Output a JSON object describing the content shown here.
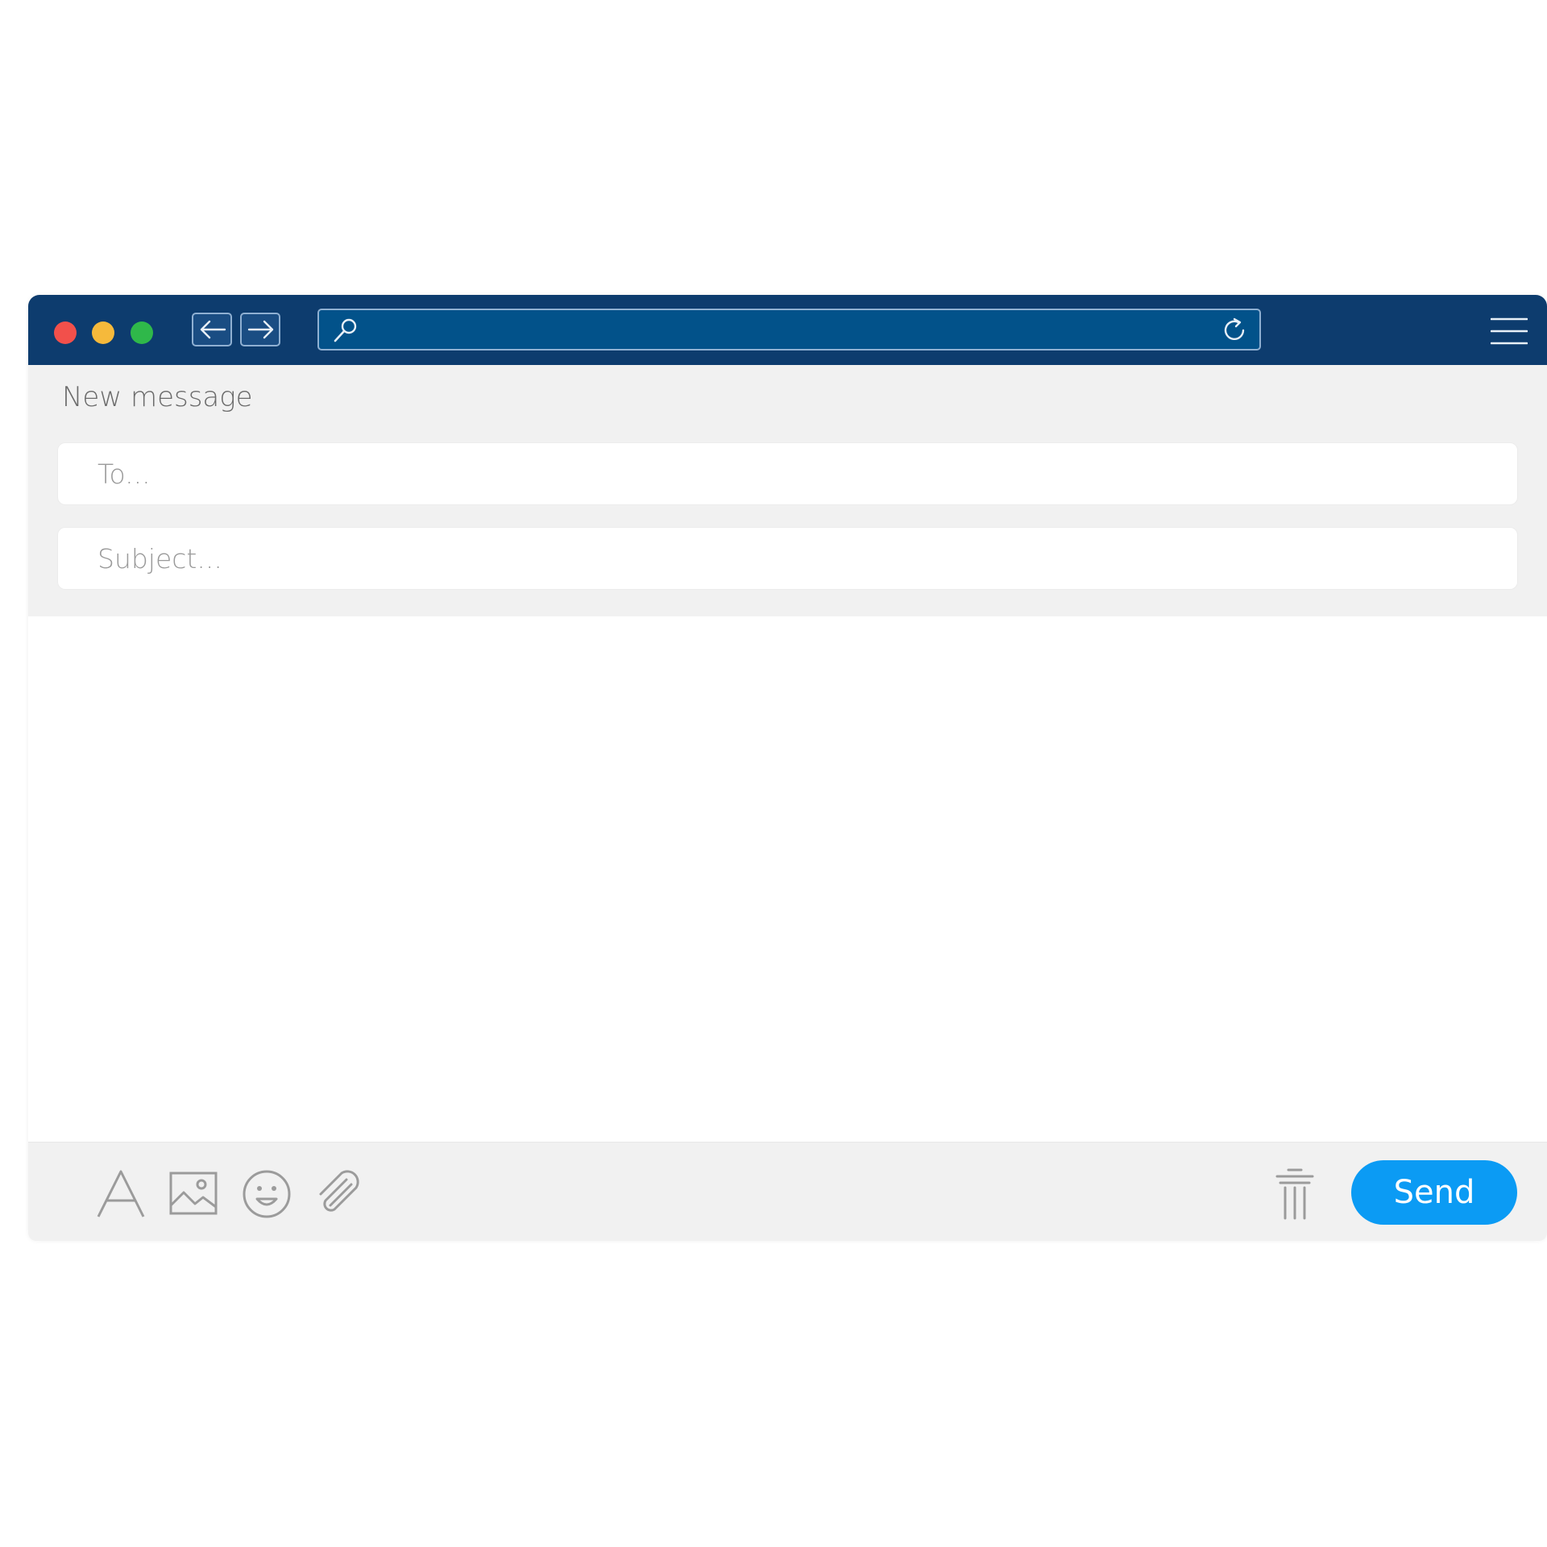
{
  "compose": {
    "heading": "New message",
    "to_placeholder": "To...",
    "subject_placeholder": "Subject...",
    "send_label": "Send"
  },
  "toolbar": {
    "icons": [
      "font-icon",
      "image-icon",
      "emoji-icon",
      "attachment-icon",
      "trash-icon"
    ]
  },
  "browser": {
    "traffic_lights": [
      "#f2504b",
      "#f6b93b",
      "#2fb84a"
    ],
    "nav_icons": [
      "back-arrow-icon",
      "forward-arrow-icon",
      "search-icon",
      "reload-icon",
      "menu-icon"
    ]
  },
  "colors": {
    "titlebar": "#0d3c6e",
    "urlbar": "#02528a",
    "send_button": "#0b9bf4",
    "panel": "#f1f1f1"
  }
}
